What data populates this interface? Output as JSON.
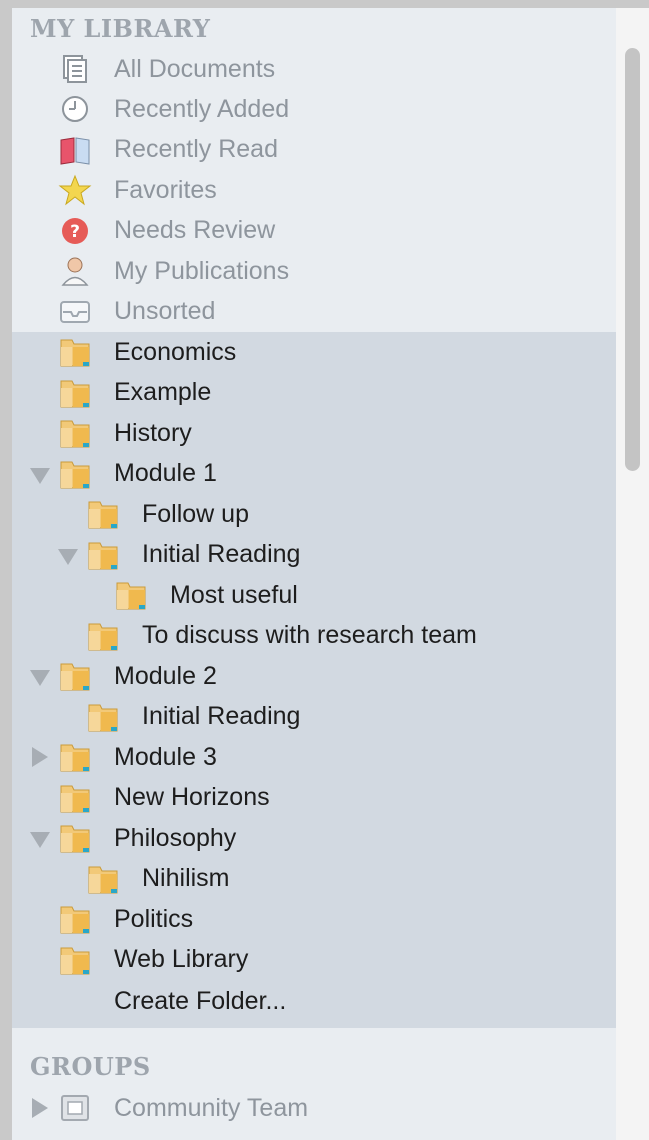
{
  "library": {
    "heading": "MY LIBRARY",
    "items": [
      {
        "label": "All Documents",
        "icon": "documents-icon"
      },
      {
        "label": "Recently Added",
        "icon": "clock-icon"
      },
      {
        "label": "Recently Read",
        "icon": "open-book-icon"
      },
      {
        "label": "Favorites",
        "icon": "star-icon"
      },
      {
        "label": "Needs Review",
        "icon": "question-icon"
      },
      {
        "label": "My Publications",
        "icon": "person-icon"
      },
      {
        "label": "Unsorted",
        "icon": "inbox-icon"
      }
    ]
  },
  "folders": [
    {
      "label": "Economics",
      "level": 0,
      "toggle": null
    },
    {
      "label": "Example",
      "level": 0,
      "toggle": null
    },
    {
      "label": "History",
      "level": 0,
      "toggle": null
    },
    {
      "label": "Module 1",
      "level": 0,
      "toggle": "expanded"
    },
    {
      "label": "Follow up",
      "level": 1,
      "toggle": null
    },
    {
      "label": "Initial Reading",
      "level": 1,
      "toggle": "expanded"
    },
    {
      "label": "Most useful",
      "level": 2,
      "toggle": null
    },
    {
      "label": "To discuss with research team",
      "level": 1,
      "toggle": null
    },
    {
      "label": "Module 2",
      "level": 0,
      "toggle": "expanded"
    },
    {
      "label": "Initial Reading",
      "level": 1,
      "toggle": null
    },
    {
      "label": "Module 3",
      "level": 0,
      "toggle": "collapsed"
    },
    {
      "label": "New Horizons",
      "level": 0,
      "toggle": null
    },
    {
      "label": "Philosophy",
      "level": 0,
      "toggle": "expanded"
    },
    {
      "label": "Nihilism",
      "level": 1,
      "toggle": null
    },
    {
      "label": "Politics",
      "level": 0,
      "toggle": null
    },
    {
      "label": "Web Library",
      "level": 0,
      "toggle": null
    }
  ],
  "create_folder_label": "Create Folder...",
  "groups": {
    "heading": "GROUPS",
    "items": [
      {
        "label": "Community Team",
        "toggle": "collapsed",
        "icon": "group-icon"
      }
    ]
  }
}
